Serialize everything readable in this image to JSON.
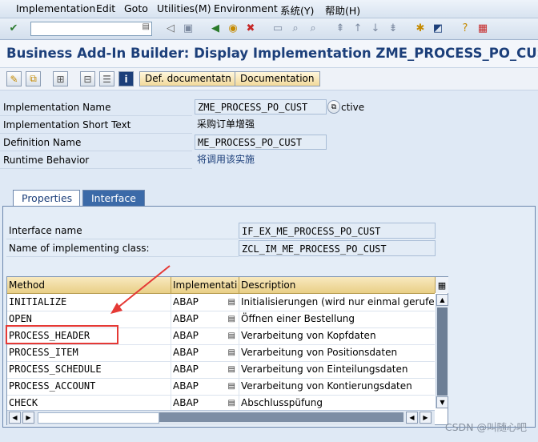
{
  "menu": [
    {
      "label": "Implementation"
    },
    {
      "label": "Edit"
    },
    {
      "label": "Goto"
    },
    {
      "label": "Utilities(M)"
    },
    {
      "label": "Environment"
    },
    {
      "label": "系统(Y)"
    },
    {
      "label": "帮助(H)"
    }
  ],
  "title": "Business Add-In Builder: Display Implementation ZME_PROCESS_PO_CUST",
  "app_toolbar": {
    "def_doc_label": "Def. documentatn",
    "doc_label": "Documentation"
  },
  "header": {
    "impl_name_label": "Implementation Name",
    "impl_name_value": "ZME_PROCESS_PO_CUST",
    "status_text": "ctive",
    "short_text_label": "Implementation Short Text",
    "short_text_value": "采购订单增强",
    "def_name_label": "Definition Name",
    "def_name_value": "ME_PROCESS_PO_CUST",
    "runtime_label": "Runtime Behavior",
    "runtime_value": "将调用该实施"
  },
  "tabs": {
    "properties": "Properties",
    "interface": "Interface"
  },
  "interface": {
    "name_label": "Interface name",
    "name_value": "IF_EX_ME_PROCESS_PO_CUST",
    "class_label": "Name of implementing class:",
    "class_value": "ZCL_IM_ME_PROCESS_PO_CUST"
  },
  "table": {
    "headers": [
      "Method",
      "Implementati",
      "Description"
    ],
    "rows": [
      {
        "method": "INITIALIZE",
        "impl": "ABAP",
        "desc": "Initialisierungen (wird nur einmal gerufen )"
      },
      {
        "method": "OPEN",
        "impl": "ABAP",
        "desc": "Öffnen einer Bestellung"
      },
      {
        "method": "PROCESS_HEADER",
        "impl": "ABAP",
        "desc": "Verarbeitung von Kopfdaten"
      },
      {
        "method": "PROCESS_ITEM",
        "impl": "ABAP",
        "desc": "Verarbeitung von Positionsdaten"
      },
      {
        "method": "PROCESS_SCHEDULE",
        "impl": "ABAP",
        "desc": "Verarbeitung von Einteilungsdaten"
      },
      {
        "method": "PROCESS_ACCOUNT",
        "impl": "ABAP",
        "desc": "Verarbeitung von Kontierungsdaten"
      },
      {
        "method": "CHECK",
        "impl": "ABAP",
        "desc": "Abschlusspüfung"
      }
    ]
  },
  "watermark": "CSDN @叫随心吧",
  "colors": {
    "title": "#1c3f7a",
    "highlight": "#e53935",
    "tab_active": "#3b6aa8"
  }
}
